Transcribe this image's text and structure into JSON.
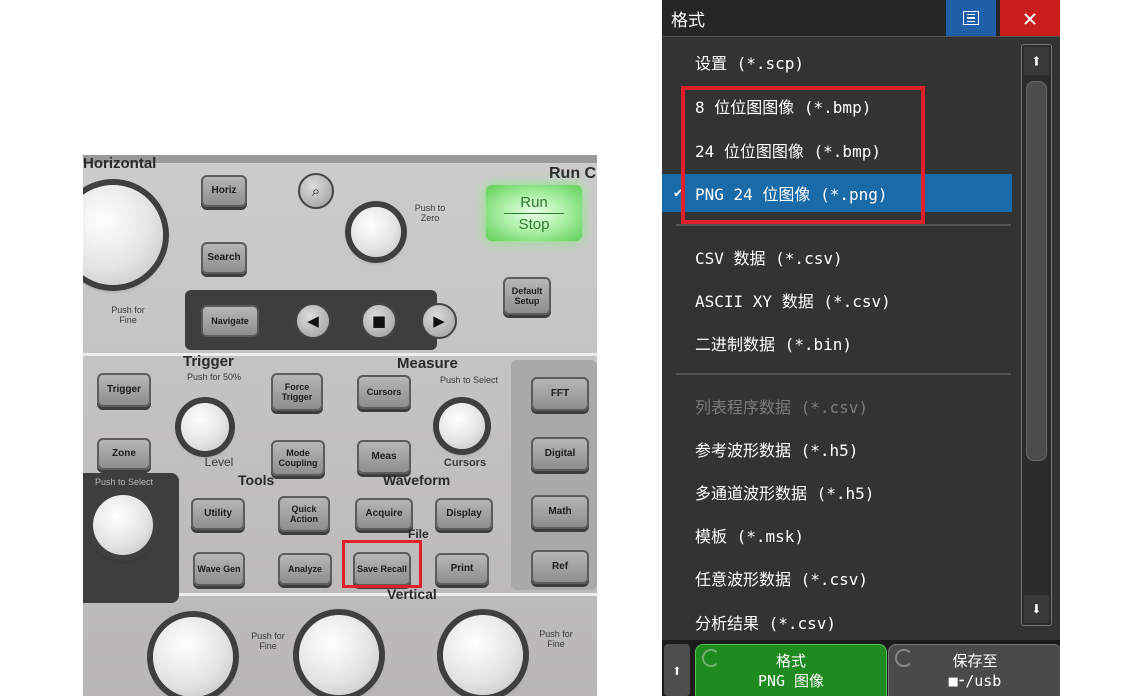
{
  "photo": {
    "section_labels": {
      "horizontal": "Horizontal",
      "run_control": "Run C",
      "trigger": "Trigger",
      "measure": "Measure",
      "tools": "Tools",
      "waveform": "Waveform",
      "file": "File",
      "vertical": "Vertical"
    },
    "small_labels": {
      "push_to_zero": "Push to Zero",
      "push_for_fine_left": "Push for Fine",
      "push_for_50": "Push for 50%",
      "push_to_select_measure": "Push to Select",
      "push_to_select_tools": "Push to Select",
      "level": "Level",
      "cursors_knob": "Cursors",
      "push_for_fine_bottom1": "Push for Fine",
      "push_for_fine_bottom2": "Push for Fine"
    },
    "buttons": {
      "horiz": "Horiz",
      "search": "Search",
      "navigate": "Navigate",
      "run": "Run",
      "stop": "Stop",
      "default_setup": "Default Setup",
      "trigger": "Trigger",
      "force_trigger": "Force Trigger",
      "zone": "Zone",
      "mode_coupling": "Mode Coupling",
      "cursors": "Cursors",
      "meas": "Meas",
      "utility": "Utility",
      "quick_action": "Quick Action",
      "acquire": "Acquire",
      "display": "Display",
      "wave_gen": "Wave Gen",
      "analyze": "Analyze",
      "save_recall": "Save Recall",
      "print": "Print",
      "fft": "FFT",
      "digital": "Digital",
      "math": "Math",
      "ref": "Ref"
    }
  },
  "dialog": {
    "title": "格式",
    "items": [
      {
        "label": "设置 (*.scp)"
      },
      {
        "label": "8 位位图图像 (*.bmp)"
      },
      {
        "label": "24 位位图图像 (*.bmp)"
      },
      {
        "label": "PNG 24 位图像 (*.png)",
        "selected": true,
        "check": "✔"
      },
      {
        "label": "CSV 数据 (*.csv)"
      },
      {
        "label": "ASCII XY 数据 (*.csv)"
      },
      {
        "label": "二进制数据 (*.bin)"
      },
      {
        "label": "列表程序数据 (*.csv)",
        "disabled": true
      },
      {
        "label": "参考波形数据 (*.h5)"
      },
      {
        "label": "多通道波形数据 (*.h5)"
      },
      {
        "label": "模板 (*.msk)"
      },
      {
        "label": "任意波形数据 (*.csv)"
      },
      {
        "label": "分析结果 (*.csv)"
      }
    ],
    "softkeys": {
      "format_title": "格式",
      "format_value": "PNG 图像",
      "save_title": "保存至",
      "save_value": "/usb"
    }
  },
  "colors": {
    "highlight": "#e2202b",
    "selection": "#1a6aa7",
    "softkey_active": "#1f8a1f",
    "close_button": "#c81e1e",
    "menu_button": "#1f5fa8"
  }
}
